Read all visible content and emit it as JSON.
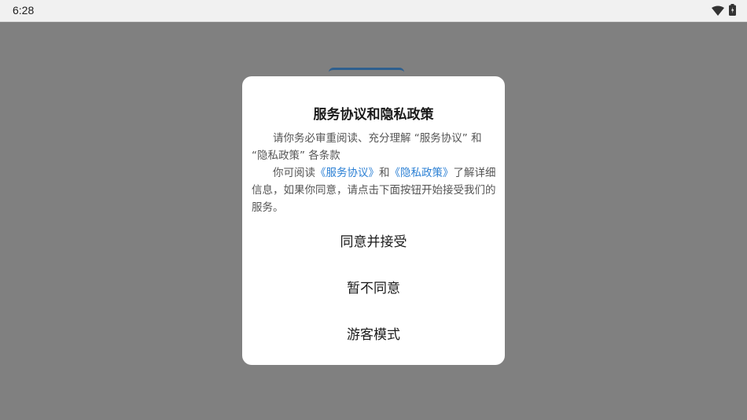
{
  "status_bar": {
    "time": "6:28",
    "icons": [
      "wifi-icon",
      "battery-icon"
    ]
  },
  "dialog": {
    "title": "服务协议和隐私政策",
    "paragraph1": "请你务必审重阅读、充分理解 “服务协议” 和 “隐私政策” 各条款",
    "paragraph2_prefix": "你可阅读",
    "link_service": "《服务协议》",
    "paragraph2_and": "和",
    "link_privacy": "《隐私政策》",
    "paragraph2_suffix": "了解详细信息，如果你同意，请点击下面按钮开始接受我们的服务。",
    "buttons": {
      "agree": "同意并接受",
      "disagree": "暂不同意",
      "guest": "游客模式"
    }
  },
  "colors": {
    "scrim": "#808080",
    "link": "#2a7fd4",
    "dialog_bg": "#ffffff"
  }
}
